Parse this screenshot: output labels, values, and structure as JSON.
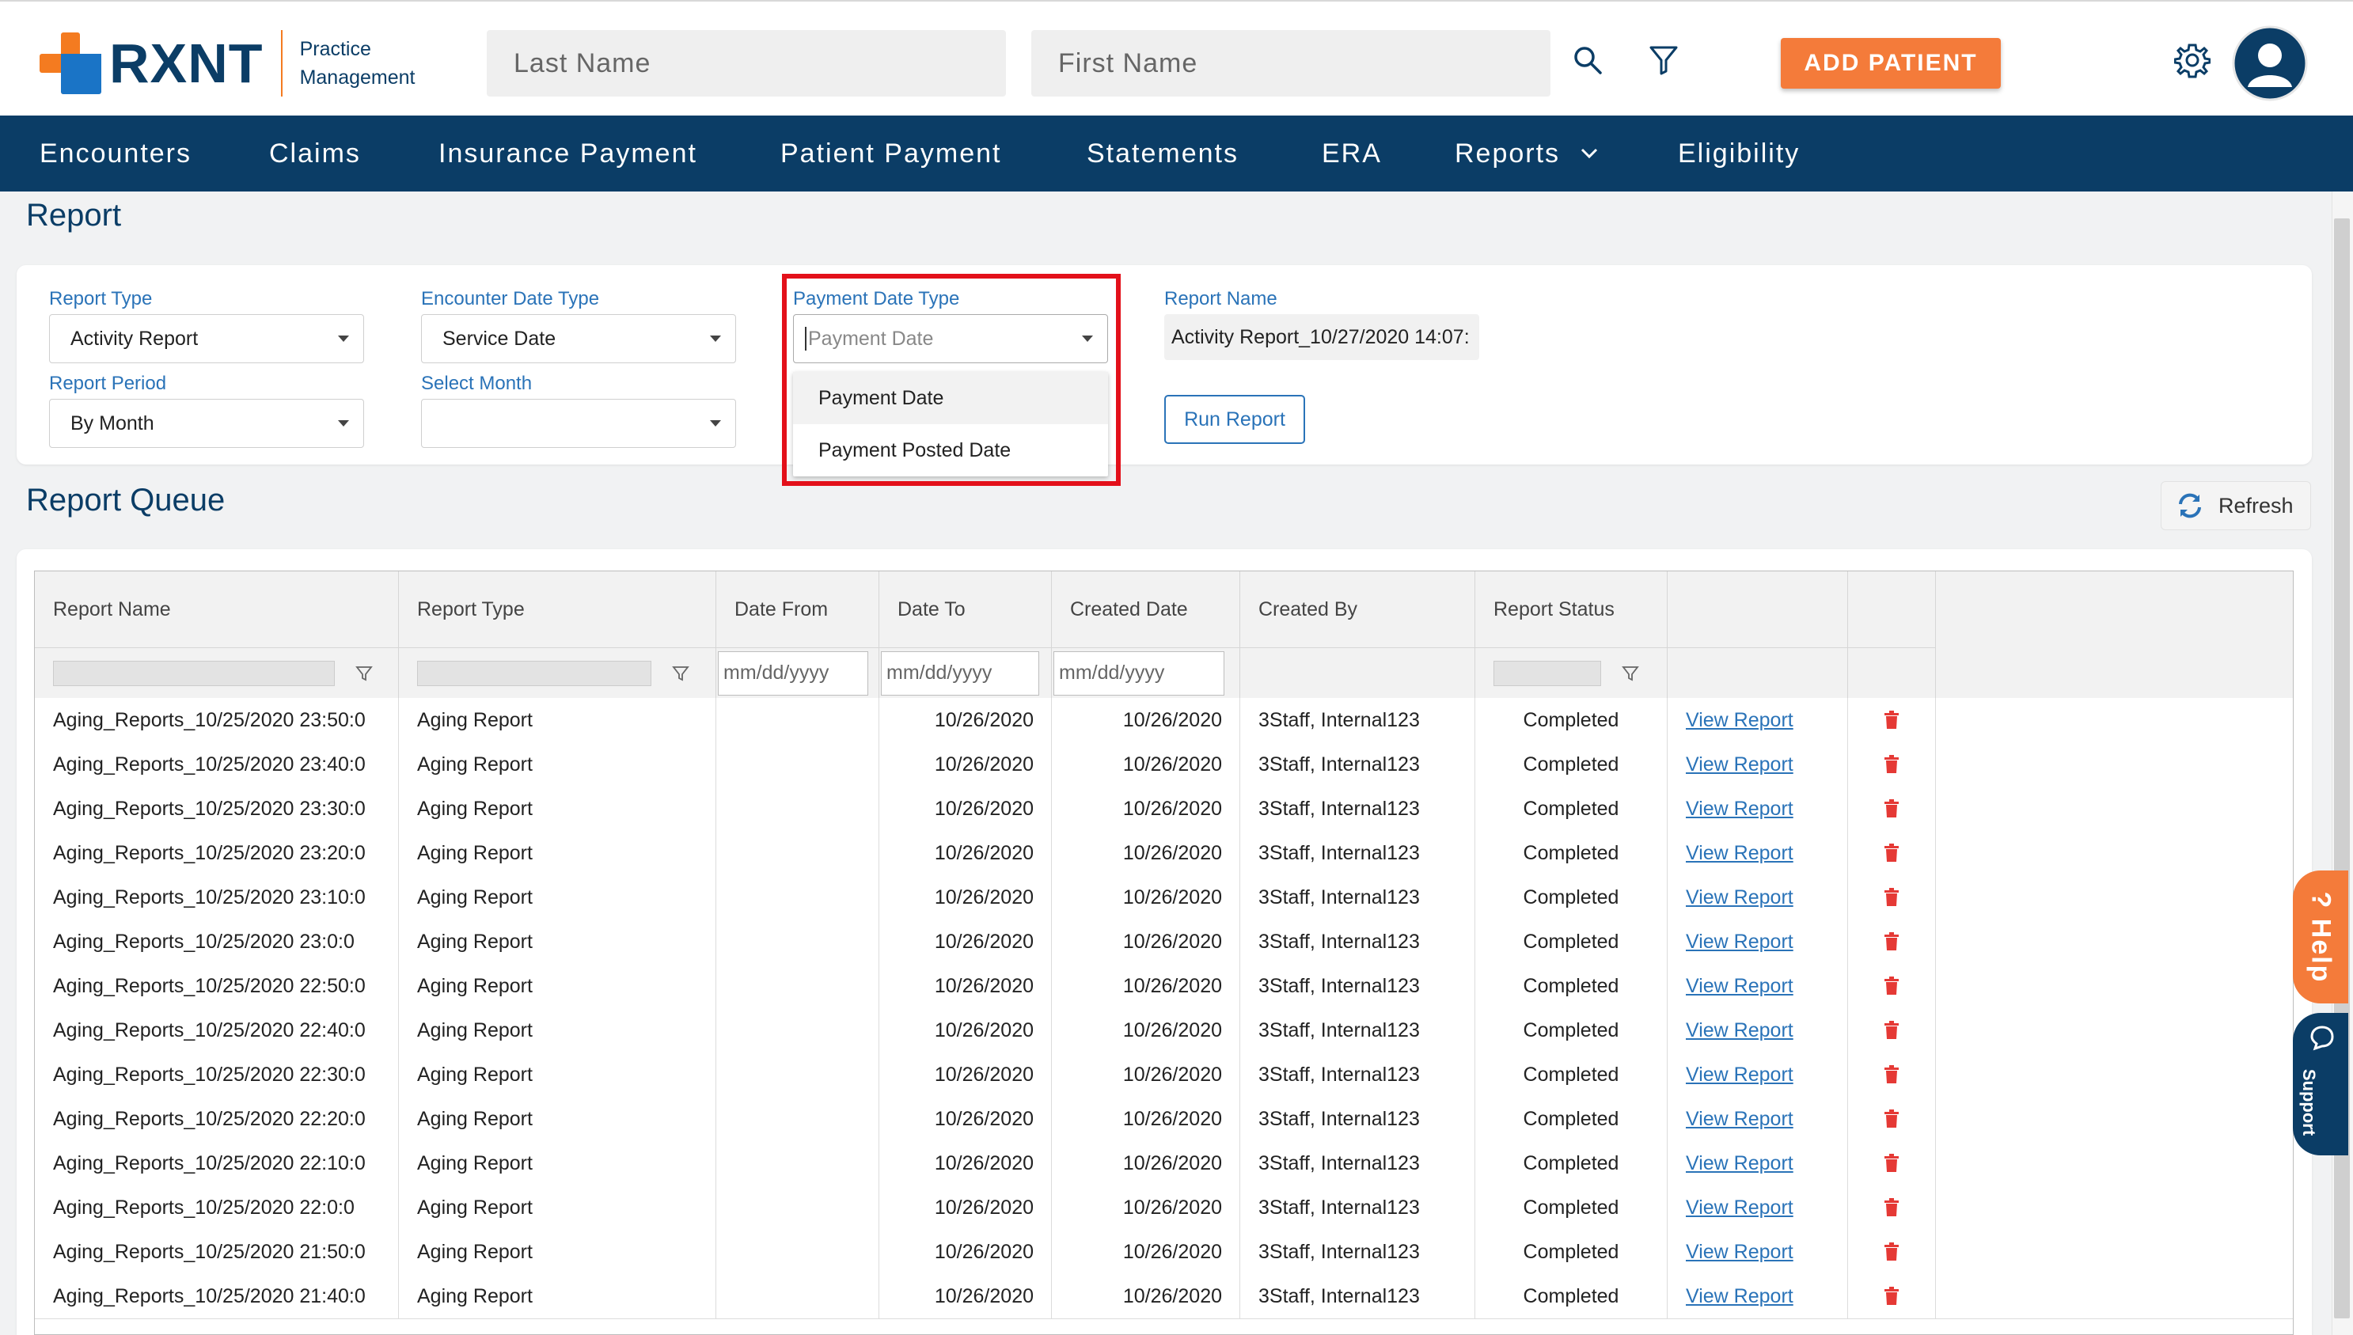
{
  "header": {
    "logo_text": "RXNT",
    "logo_sub1": "Practice",
    "logo_sub2": "Management",
    "last_name_placeholder": "Last Name",
    "first_name_placeholder": "First Name",
    "add_patient_label": "ADD PATIENT"
  },
  "nav": {
    "items": [
      "Encounters",
      "Claims",
      "Insurance Payment",
      "Patient Payment",
      "Statements",
      "ERA",
      "Reports",
      "Eligibility"
    ]
  },
  "page": {
    "title": "Report",
    "queue_title": "Report Queue",
    "refresh_label": "Refresh"
  },
  "form": {
    "report_type_label": "Report Type",
    "report_type_value": "Activity Report",
    "report_period_label": "Report Period",
    "report_period_value": "By Month",
    "encounter_date_type_label": "Encounter Date Type",
    "encounter_date_type_value": "Service Date",
    "select_month_label": "Select Month",
    "select_month_value": "",
    "payment_date_type_label": "Payment Date Type",
    "payment_date_type_placeholder": "Payment Date",
    "payment_date_type_options": [
      "Payment Date",
      "Payment Posted Date"
    ],
    "report_name_label": "Report Name",
    "report_name_value": "Activity Report_10/27/2020 14:07:",
    "run_report_label": "Run Report"
  },
  "table": {
    "columns": [
      "Report Name",
      "Report Type",
      "Date From",
      "Date To",
      "Created Date",
      "Created By",
      "Report Status",
      "",
      ""
    ],
    "date_placeholder": "mm/dd/yyyy",
    "rows": [
      {
        "name": "Aging_Reports_10/25/2020 23:50:0",
        "type": "Aging Report",
        "from": "",
        "to": "10/26/2020",
        "created": "10/26/2020",
        "by": "3Staff, Internal123",
        "status": "Completed",
        "link": "View Report"
      },
      {
        "name": "Aging_Reports_10/25/2020 23:40:0",
        "type": "Aging Report",
        "from": "",
        "to": "10/26/2020",
        "created": "10/26/2020",
        "by": "3Staff, Internal123",
        "status": "Completed",
        "link": "View Report"
      },
      {
        "name": "Aging_Reports_10/25/2020 23:30:0",
        "type": "Aging Report",
        "from": "",
        "to": "10/26/2020",
        "created": "10/26/2020",
        "by": "3Staff, Internal123",
        "status": "Completed",
        "link": "View Report"
      },
      {
        "name": "Aging_Reports_10/25/2020 23:20:0",
        "type": "Aging Report",
        "from": "",
        "to": "10/26/2020",
        "created": "10/26/2020",
        "by": "3Staff, Internal123",
        "status": "Completed",
        "link": "View Report"
      },
      {
        "name": "Aging_Reports_10/25/2020 23:10:0",
        "type": "Aging Report",
        "from": "",
        "to": "10/26/2020",
        "created": "10/26/2020",
        "by": "3Staff, Internal123",
        "status": "Completed",
        "link": "View Report"
      },
      {
        "name": "Aging_Reports_10/25/2020 23:0:0",
        "type": "Aging Report",
        "from": "",
        "to": "10/26/2020",
        "created": "10/26/2020",
        "by": "3Staff, Internal123",
        "status": "Completed",
        "link": "View Report"
      },
      {
        "name": "Aging_Reports_10/25/2020 22:50:0",
        "type": "Aging Report",
        "from": "",
        "to": "10/26/2020",
        "created": "10/26/2020",
        "by": "3Staff, Internal123",
        "status": "Completed",
        "link": "View Report"
      },
      {
        "name": "Aging_Reports_10/25/2020 22:40:0",
        "type": "Aging Report",
        "from": "",
        "to": "10/26/2020",
        "created": "10/26/2020",
        "by": "3Staff, Internal123",
        "status": "Completed",
        "link": "View Report"
      },
      {
        "name": "Aging_Reports_10/25/2020 22:30:0",
        "type": "Aging Report",
        "from": "",
        "to": "10/26/2020",
        "created": "10/26/2020",
        "by": "3Staff, Internal123",
        "status": "Completed",
        "link": "View Report"
      },
      {
        "name": "Aging_Reports_10/25/2020 22:20:0",
        "type": "Aging Report",
        "from": "",
        "to": "10/26/2020",
        "created": "10/26/2020",
        "by": "3Staff, Internal123",
        "status": "Completed",
        "link": "View Report"
      },
      {
        "name": "Aging_Reports_10/25/2020 22:10:0",
        "type": "Aging Report",
        "from": "",
        "to": "10/26/2020",
        "created": "10/26/2020",
        "by": "3Staff, Internal123",
        "status": "Completed",
        "link": "View Report"
      },
      {
        "name": "Aging_Reports_10/25/2020 22:0:0",
        "type": "Aging Report",
        "from": "",
        "to": "10/26/2020",
        "created": "10/26/2020",
        "by": "3Staff, Internal123",
        "status": "Completed",
        "link": "View Report"
      },
      {
        "name": "Aging_Reports_10/25/2020 21:50:0",
        "type": "Aging Report",
        "from": "",
        "to": "10/26/2020",
        "created": "10/26/2020",
        "by": "3Staff, Internal123",
        "status": "Completed",
        "link": "View Report"
      },
      {
        "name": "Aging_Reports_10/25/2020 21:40:0",
        "type": "Aging Report",
        "from": "",
        "to": "10/26/2020",
        "created": "10/26/2020",
        "by": "3Staff, Internal123",
        "status": "Completed",
        "link": "View Report"
      }
    ]
  },
  "widgets": {
    "help_label": "? Help",
    "support_label": "Support"
  },
  "icons": {
    "search": "search-icon",
    "filter": "filter-icon",
    "settings": "gear-icon",
    "avatar": "user-avatar-icon",
    "refresh": "refresh-icon",
    "delete": "trash-icon",
    "chevron": "chevron-down-icon"
  },
  "colors": {
    "brand_navy": "#0b3d66",
    "brand_orange": "#f47b3a",
    "link_blue": "#2a73b8",
    "highlight_red": "#e3101a",
    "delete_red": "#e53935"
  }
}
